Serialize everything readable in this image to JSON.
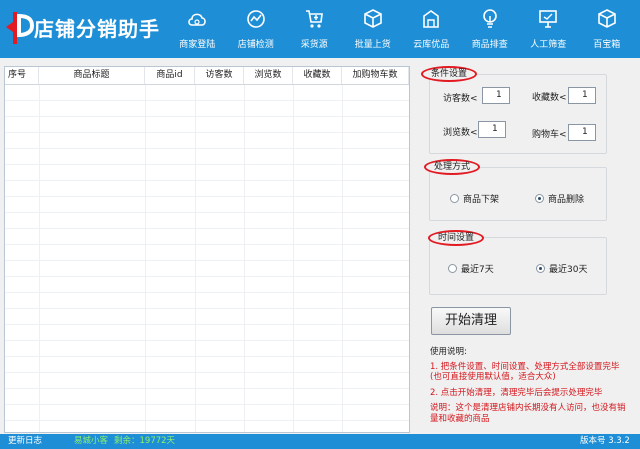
{
  "app": {
    "title": "店铺分销助手"
  },
  "nav": [
    {
      "label": "商家登陆",
      "icon": "cloud-icon"
    },
    {
      "label": "店铺检测",
      "icon": "chart-icon"
    },
    {
      "label": "采货源",
      "icon": "cart-icon"
    },
    {
      "label": "批量上货",
      "icon": "cube-icon"
    },
    {
      "label": "云库优品",
      "icon": "building-icon"
    },
    {
      "label": "商品排查",
      "icon": "bulb-icon"
    },
    {
      "label": "人工筛查",
      "icon": "monitor-icon"
    },
    {
      "label": "百宝箱",
      "icon": "box-icon"
    }
  ],
  "table": {
    "columns": [
      "序号",
      "商品标题",
      "商品id",
      "访客数",
      "浏览数",
      "收藏数",
      "加购物车数"
    ],
    "rows": []
  },
  "conditions": {
    "legend": "条件设置",
    "visitors_label": "访客数",
    "visitors_value": "1",
    "favorites_label": "收藏数",
    "favorites_value": "1",
    "views_label": "浏览数",
    "views_value": "1",
    "cart_label": "购物车",
    "cart_value": "1",
    "lt": "<"
  },
  "handling": {
    "legend": "处理方式",
    "option_delist": "商品下架",
    "option_delete": "商品删除",
    "selected": "商品删除"
  },
  "time": {
    "legend": "时间设置",
    "option_7": "最近7天",
    "option_30": "最近30天",
    "selected": "最近30天"
  },
  "start_button": "开始清理",
  "instructions": {
    "title": "使用说明:",
    "step1": "1. 把条件设置、时间设置、处理方式全部设置完毕",
    "step1b": "(也可直接使用默认值，适合大众)",
    "step2": "2. 点击开始清理，清理完毕后会提示处理完毕",
    "note": "说明：这个是清理店铺内长期没有人访问，也没有销量和收藏的商品"
  },
  "statusbar": {
    "log": "更新日志",
    "user": "易城小客",
    "remaining": "剩余：19772天",
    "version": "版本号 3.3.2"
  },
  "colors": {
    "header": "#1e8fd6",
    "accent_red": "#e21b23",
    "note_red": "#d4161c"
  }
}
